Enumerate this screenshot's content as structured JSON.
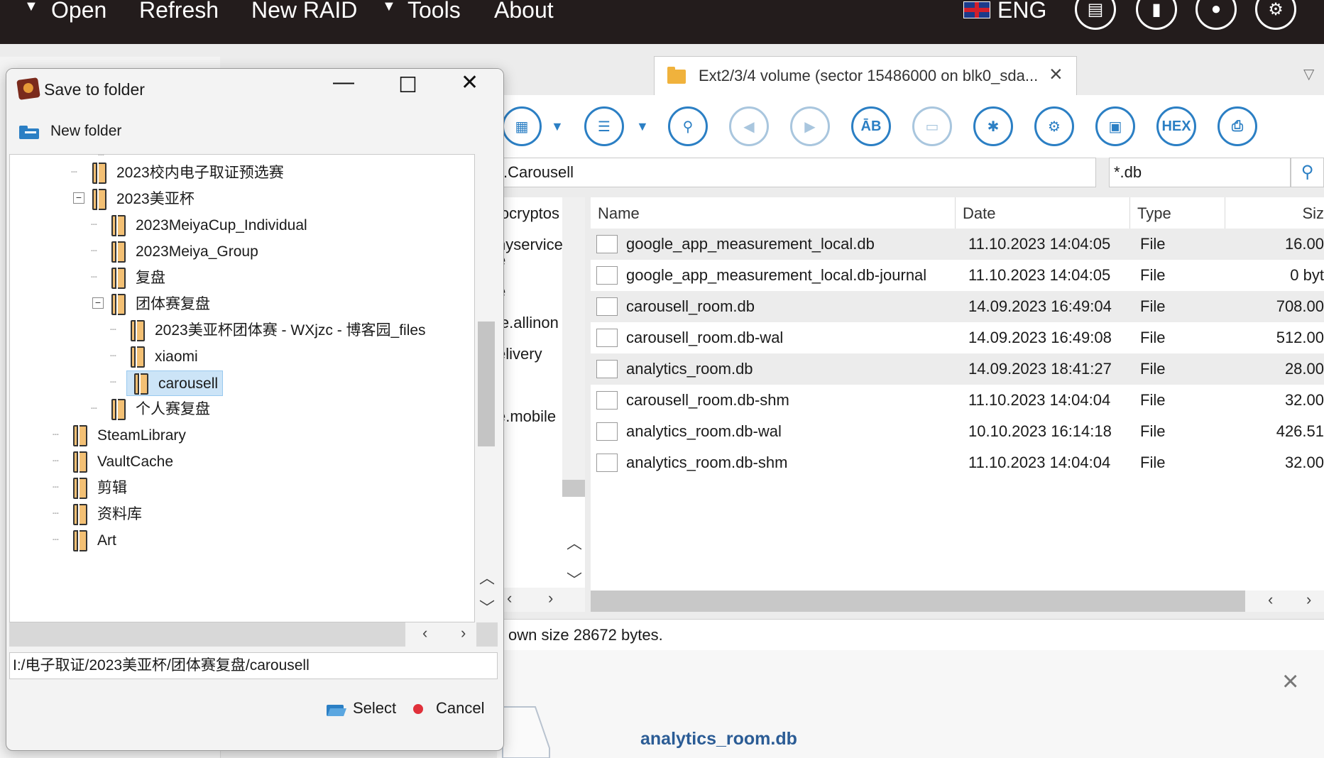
{
  "menubar": {
    "items": [
      "Open",
      "Refresh",
      "New RAID",
      "Tools",
      "About"
    ],
    "language": "ENG",
    "icon_buttons": [
      "list-window-icon",
      "panel-icon",
      "user-icon",
      "gear-icon"
    ]
  },
  "tab": {
    "label": "Ext2/3/4 volume (sector 15486000 on blk0_sda..."
  },
  "toolbar": {
    "buttons": [
      "view-grid-icon",
      "view-list-icon",
      "binoculars-icon",
      "previous-icon",
      "next-icon",
      "text-ab-icon",
      "image-card-icon",
      "file-add-icon",
      "file-settings-icon",
      "save-file-icon",
      "hex-icon",
      "print-icon"
    ],
    "hex_label": "HEX",
    "text_label": "ĀB"
  },
  "path_field": {
    "value": ".Carousell"
  },
  "filter_field": {
    "value": "*.db"
  },
  "tree_pane": {
    "items": [
      "locryptos",
      "nyservice",
      "e",
      "e",
      "ie.allinon",
      "elivery",
      "e.mobile"
    ]
  },
  "file_list": {
    "columns": [
      "Name",
      "Date",
      "Type",
      "Siz"
    ],
    "rows": [
      {
        "name": "google_app_measurement_local.db",
        "date": "11.10.2023 14:04:05",
        "type": "File",
        "size": "16.00"
      },
      {
        "name": "google_app_measurement_local.db-journal",
        "date": "11.10.2023 14:04:05",
        "type": "File",
        "size": "0 byt"
      },
      {
        "name": "carousell_room.db",
        "date": "14.09.2023 16:49:04",
        "type": "File",
        "size": "708.00"
      },
      {
        "name": "carousell_room.db-wal",
        "date": "14.09.2023 16:49:08",
        "type": "File",
        "size": "512.00"
      },
      {
        "name": "analytics_room.db",
        "date": "14.09.2023 18:41:27",
        "type": "File",
        "size": "28.00"
      },
      {
        "name": "carousell_room.db-shm",
        "date": "11.10.2023 14:04:04",
        "type": "File",
        "size": "32.00"
      },
      {
        "name": "analytics_room.db-wal",
        "date": "10.10.2023 16:14:18",
        "type": "File",
        "size": "426.51"
      },
      {
        "name": "analytics_room.db-shm",
        "date": "11.10.2023 14:04:04",
        "type": "File",
        "size": "32.00"
      }
    ]
  },
  "status_bar": {
    "text": "own size 28672 bytes."
  },
  "preview": {
    "file_name": "analytics_room.db"
  },
  "dialog": {
    "title": "Save to folder",
    "new_folder_label": "New folder",
    "tree": [
      {
        "label": "2023校内电子取证预选赛"
      },
      {
        "label": "2023美亚杯"
      },
      {
        "label": "2023MeiyaCup_Individual"
      },
      {
        "label": "2023Meiya_Group"
      },
      {
        "label": "复盘"
      },
      {
        "label": "团体赛复盘"
      },
      {
        "label": "2023美亚杯团体赛 - WXjzc - 博客园_files"
      },
      {
        "label": "xiaomi"
      },
      {
        "label": "carousell"
      },
      {
        "label": "个人赛复盘"
      },
      {
        "label": "SteamLibrary"
      },
      {
        "label": "VaultCache"
      },
      {
        "label": "剪辑"
      },
      {
        "label": "资料库"
      },
      {
        "label": "Art"
      }
    ],
    "path_value": "I:/电子取证/2023美亚杯/团体赛复盘/carousell",
    "select_label": "Select",
    "cancel_label": "Cancel"
  }
}
